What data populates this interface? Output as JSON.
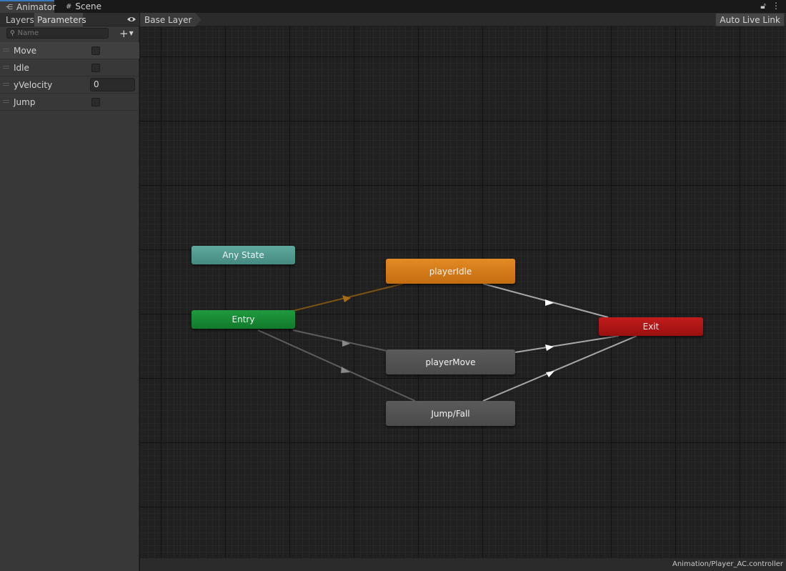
{
  "window_tabs": [
    {
      "label": "Animator",
      "icon": "animator-icon",
      "active": true
    },
    {
      "label": "Scene",
      "icon": "scene-grid-icon",
      "active": false
    }
  ],
  "left_panel": {
    "tabs": [
      "Layers",
      "Parameters"
    ],
    "search_placeholder": "Name",
    "parameters": [
      {
        "name": "Move",
        "type": "bool"
      },
      {
        "name": "Idle",
        "type": "bool"
      },
      {
        "name": "yVelocity",
        "type": "float",
        "value": "0"
      },
      {
        "name": "Jump",
        "type": "bool"
      }
    ]
  },
  "breadcrumb": "Base Layer",
  "auto_live_link": "Auto Live Link",
  "states": {
    "any_state": "Any State",
    "entry": "Entry",
    "player_idle": "playerIdle",
    "player_move": "playerMove",
    "jump_fall": "Jump/Fall",
    "exit": "Exit"
  },
  "colors": {
    "any_state": "#5ea99e",
    "entry": "#1f9a3e",
    "default_state": "#e38a24",
    "state": "#555555",
    "exit": "#c11c1c",
    "default_transition": "#8a5a14",
    "transition": "#9a9a9a"
  },
  "status_path": "Animation/Player_AC.controller"
}
